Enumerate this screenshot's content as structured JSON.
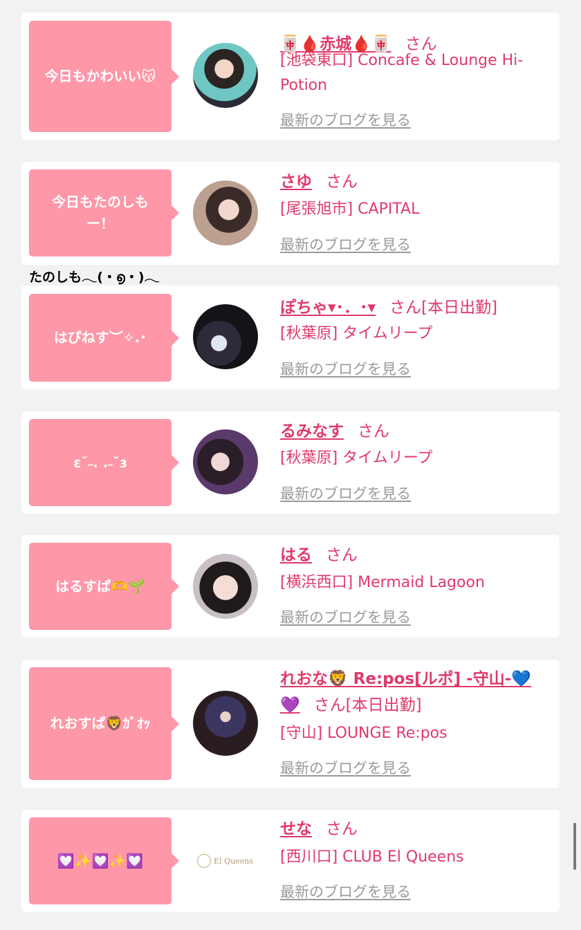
{
  "cards": [
    {
      "bubble": "今日もかわいい😽",
      "name": "🀄🩸赤城🩸🀄",
      "name_cont": "",
      "san": "さん",
      "attendance": "",
      "shop": "[池袋東口] Concafe & Lounge Hi-Potion",
      "blog": "最新のブログを見る"
    },
    {
      "bubble": "今日もたのしもー！",
      "name": "さゆ",
      "name_cont": "",
      "san": "さん",
      "attendance": "",
      "shop": "[尾張旭市] CAPITAL",
      "blog": "最新のブログを見る"
    },
    {
      "bubble": "はぴねす︶✧.･",
      "name": "ぽちゃ▾･．･▾",
      "name_cont": "",
      "san": "さん",
      "attendance": "[本日出勤]",
      "shop": "[秋葉原] タイムリープ",
      "blog": "最新のブログを見る"
    },
    {
      "bubble": "ɛ˘˶. .˶˘ɜ",
      "name": "るみなす",
      "name_cont": "",
      "san": "さん",
      "attendance": "",
      "shop": "[秋葉原] タイムリープ",
      "blog": "最新のブログを見る"
    },
    {
      "bubble": "はるすぱ🫶🌱",
      "name": "はる",
      "name_cont": "",
      "san": "さん",
      "attendance": "",
      "shop": "[横浜西口] Mermaid Lagoon",
      "blog": "最新のブログを見る"
    },
    {
      "bubble": "れおすぱ🦁ｶﾞｵｯ",
      "name": "れおな🦁 Re:pos[ルポ] -守山-💙",
      "name_cont": "💜",
      "san": "さん",
      "attendance": "[本日出勤]",
      "shop": "[守山] LOUNGE Re:pos",
      "blog": "最新のブログを見る"
    },
    {
      "bubble": "💟✨💟✨💟",
      "name": "せな",
      "name_cont": "",
      "san": "さん",
      "attendance": "",
      "shop": "[西川口] CLUB El Queens",
      "blog": "最新のブログを見る"
    }
  ],
  "status_message": "たのしも𓂃(・൭・)𓂃",
  "logo_text": "El Queens",
  "colors": {
    "bubble": "#fe97a8",
    "name": "#e0396b",
    "link_gray": "#9a9a9a",
    "background": "#f2f2f2"
  }
}
